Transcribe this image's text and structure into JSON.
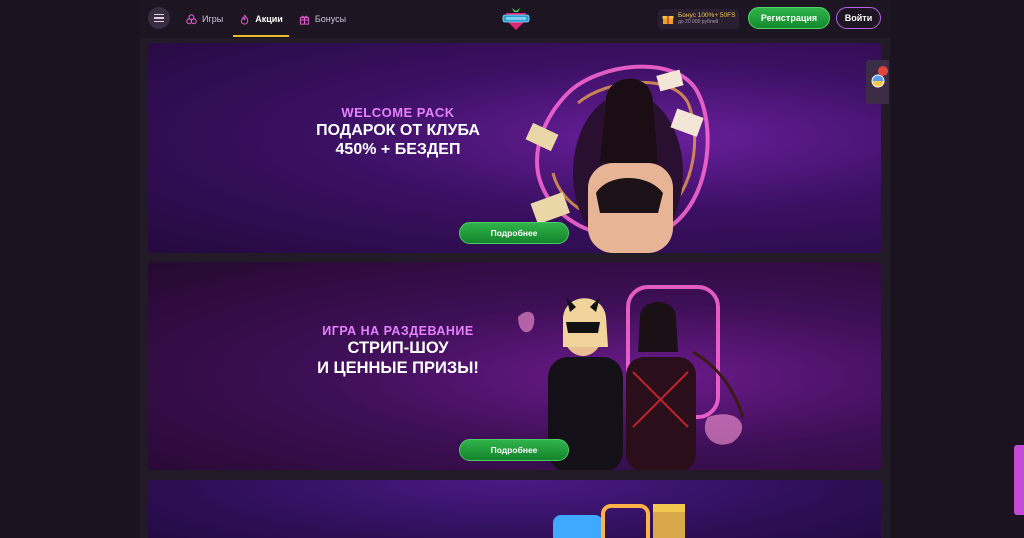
{
  "header": {
    "nav": [
      {
        "label": "Игры",
        "icon": "games-icon"
      },
      {
        "label": "Акции",
        "icon": "fire-icon"
      },
      {
        "label": "Бонусы",
        "icon": "gift-icon"
      }
    ],
    "active_nav": "Акции",
    "bonus": {
      "line1": "Бонус 100%+ 50FS",
      "line2": "до 20 000 рублей"
    },
    "register_label": "Регистрация",
    "login_label": "Войти"
  },
  "banners": [
    {
      "kicker": "WELCOME PACK",
      "line1": "ПОДАРОК ОТ КЛУБА",
      "line2": "450% + БЕЗДЕП",
      "button": "Подробнее"
    },
    {
      "kicker": "ИГРА НА РАЗДЕВАНИЕ",
      "line1": "СТРИП-ШОУ",
      "line2": "И ЦЕННЫЕ ПРИЗЫ!",
      "button": "Подробнее"
    }
  ],
  "colors": {
    "accent_pink": "#e680ff",
    "button_green": "#1f9c3a",
    "active_underline": "#e7b92f",
    "background": "#1b1420"
  }
}
